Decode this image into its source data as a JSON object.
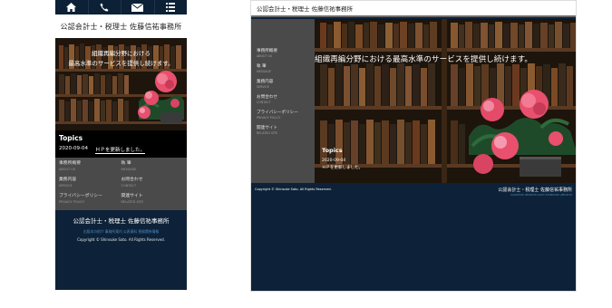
{
  "mobile": {
    "topbar": {
      "icons": [
        "home-icon",
        "phone-icon",
        "mail-icon",
        "menu-icon"
      ]
    },
    "brand": "公認会計士・税理士 佐藤信祐事務所",
    "hero_copy_line1": "組織再編分野における",
    "hero_copy_line2": "最高水準のサービスを提供し続けます。",
    "topics": {
      "title": "Topics",
      "date": "2020-09-04",
      "text": "ＨＰを更新しました。"
    },
    "nav": [
      {
        "label": "事務所概要",
        "en": "ABOUT US"
      },
      {
        "label": "執 筆",
        "en": "MESSAGE"
      },
      {
        "label": "業務内容",
        "en": "SERVICE"
      },
      {
        "label": "お問合わせ",
        "en": "CONTACT"
      },
      {
        "label": "プライバシーポリシー",
        "en": "PRIVACY POLICY"
      },
      {
        "label": "関連サイト",
        "en": "RELATED SITE"
      }
    ],
    "footer": {
      "name": "公認会計士・税理士 佐藤信祐事務所",
      "links": "出版本の紹介 事務所案内 公表資料 税務関係情報",
      "copyright": "Copyright © Shinsuke Sato. All Rights Reserved."
    }
  },
  "desktop": {
    "header_title": "公認会計士・税理士 佐藤信祐事務所",
    "nav": [
      {
        "label": "事務所概要",
        "en": "ABOUT US"
      },
      {
        "label": "執 筆",
        "en": "MESSAGE"
      },
      {
        "label": "業務内容",
        "en": "SERVICE"
      },
      {
        "label": "お問合わせ",
        "en": "CONTACT"
      },
      {
        "label": "プライバシーポリシー",
        "en": "PRIVACY POLICY"
      },
      {
        "label": "関連サイト",
        "en": "RELATED SITE"
      }
    ],
    "hero_copy": "組織再編分野における最高水準のサービスを提供し続けます。",
    "topics": {
      "title": "Topics",
      "date": "2020-09-04",
      "text": "ＨＰを更新しました。"
    },
    "footer": {
      "copyright": "Copyright © Shinsuke Sato. All Rights Reserved.",
      "name": "公認会計士・税理士 佐藤信祐事務所",
      "links": "KAIKEISHI ZEIRISHI SATO SHINSUKE JIMUSHO"
    }
  },
  "colors": {
    "navy": "#0d2238",
    "sidebar_gray": "#4a4a4a",
    "link_blue": "#4a8bc0",
    "flower_pink": "#e8506e"
  }
}
